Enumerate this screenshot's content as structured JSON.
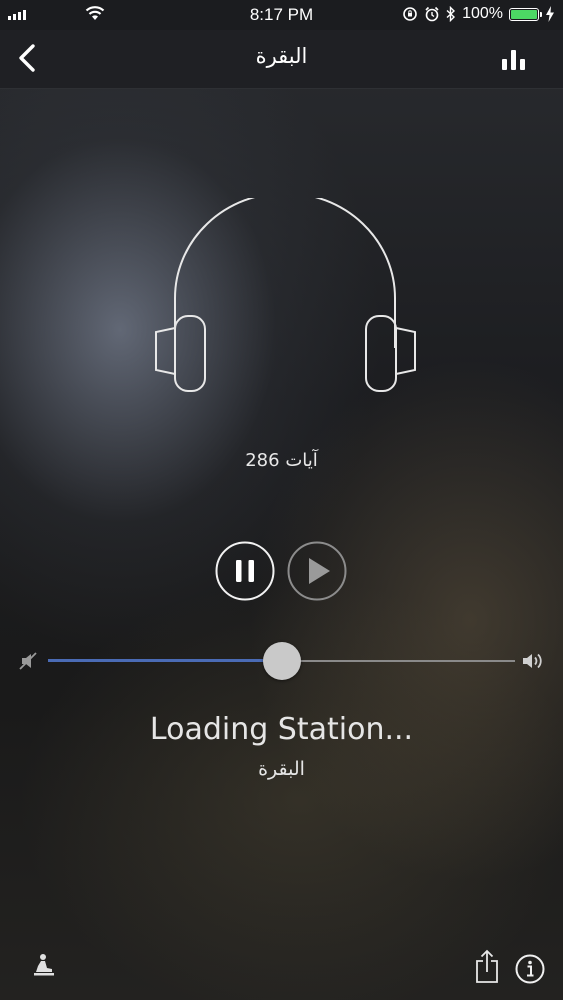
{
  "status_bar": {
    "time": "8:17 PM",
    "battery_percent": "100%",
    "battery_level": 1.0,
    "icons": [
      "signal-icon",
      "wifi-icon",
      "rotation-lock-icon",
      "alarm-icon",
      "bluetooth-icon",
      "battery-icon",
      "charging-icon"
    ]
  },
  "nav": {
    "title": "البقرة",
    "back_icon": "chevron-left-icon",
    "right_icon": "equalizer-icon"
  },
  "player": {
    "artwork_icon": "headphones-icon",
    "ayat_label": "آيات 286",
    "pause_icon": "pause-icon",
    "play_icon": "play-icon",
    "volume_level": 0.5,
    "mute_icon": "volume-mute-icon",
    "volume_max_icon": "volume-icon",
    "accent_color": "#4a6bb5"
  },
  "status": {
    "title": "Loading Station...",
    "subtitle": "البقرة"
  },
  "footer": {
    "left_icon": "prayer-icon",
    "share_icon": "share-icon",
    "info_icon": "info-icon"
  }
}
